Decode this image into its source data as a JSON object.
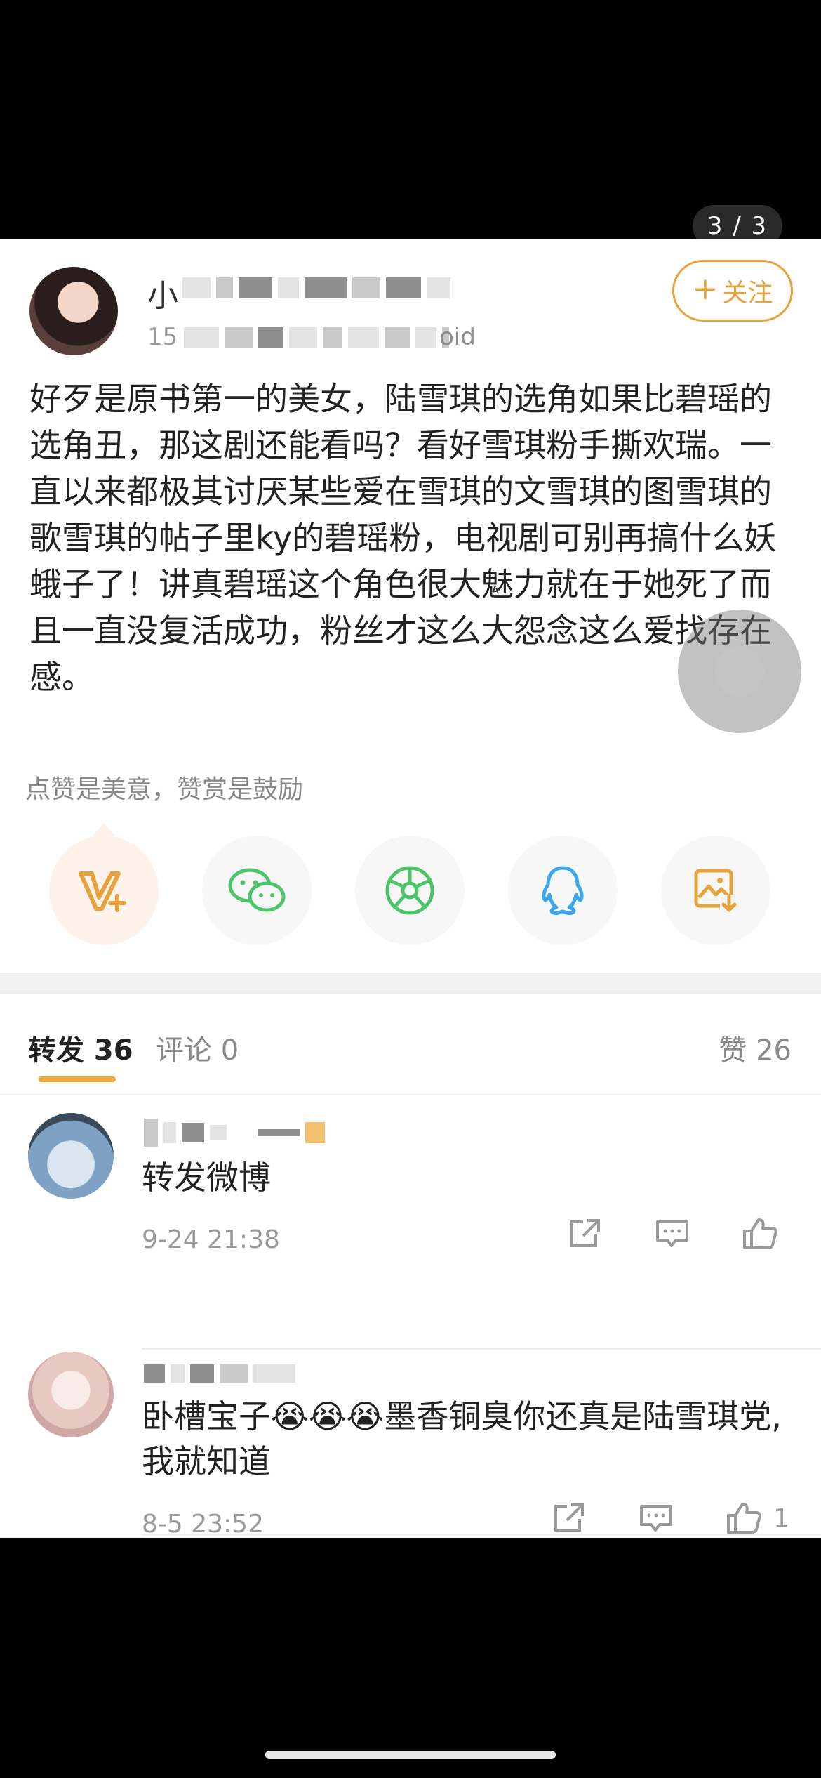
{
  "viewer": {
    "page_counter": "3 / 3"
  },
  "post": {
    "username_prefix": "小",
    "meta_prefix": "15",
    "meta_suffix": "oid",
    "follow_label": "关注",
    "body": "好歹是原书第一的美女，陆雪琪的选角如果比碧瑶的选角丑，那这剧还能看吗？看好雪琪粉手撕欢瑞。一直以来都极其讨厌某些爱在雪琪的文雪琪的图雪琪的歌雪琪的帖子里ky的碧瑶粉，电视剧可别再搞什么妖蛾子了！讲真碧瑶这个角色很大魅力就在于她死了而且一直没复活成功，粉丝才这么大怨念这么爱找存在感。",
    "reward_hint": "点赞是美意，赞赏是鼓励"
  },
  "share": {
    "icons": [
      "vplus-icon",
      "wechat-icon",
      "moments-icon",
      "qq-icon",
      "save-image-icon"
    ]
  },
  "tabs": {
    "forward": "转发 36",
    "comment": "评论 0",
    "like": "赞 26"
  },
  "comments": [
    {
      "text": "转发微博",
      "time": "9-24 21:38",
      "likes": ""
    },
    {
      "text": "卧槽宝子😭😭😭墨香铜臭你还真是陆雪琪党,我就知道",
      "time": "8-5 23:52",
      "likes": "1"
    }
  ],
  "colors": {
    "accent": "#e8a23c",
    "tab_underline": "#f4a838",
    "wechat": "#4cc56a",
    "qq": "#3aa6ee"
  }
}
